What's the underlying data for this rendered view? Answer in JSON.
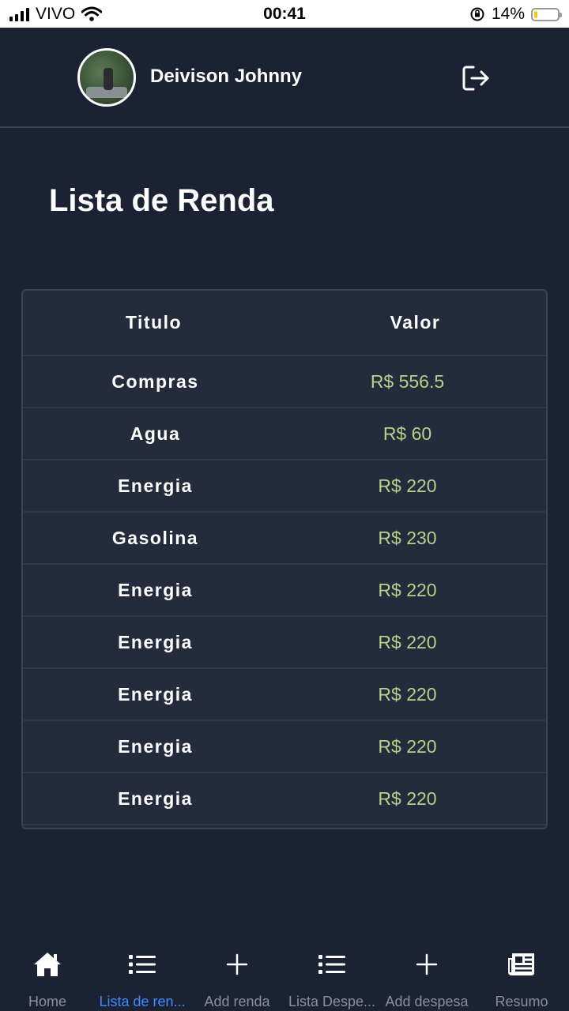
{
  "status_bar": {
    "carrier": "VIVO",
    "time": "00:41",
    "battery": "14%",
    "battery_level": 0.14
  },
  "header": {
    "user_name": "Deivison Johnny"
  },
  "page": {
    "title": "Lista de Renda"
  },
  "table": {
    "columns": [
      "Titulo",
      "Valor"
    ],
    "rows": [
      {
        "titulo": "Compras",
        "valor": "R$ 556.5"
      },
      {
        "titulo": "Agua",
        "valor": "R$ 60"
      },
      {
        "titulo": "Energia",
        "valor": "R$ 220"
      },
      {
        "titulo": "Gasolina",
        "valor": "R$ 230"
      },
      {
        "titulo": "Energia",
        "valor": "R$ 220"
      },
      {
        "titulo": "Energia",
        "valor": "R$ 220"
      },
      {
        "titulo": "Energia",
        "valor": "R$ 220"
      },
      {
        "titulo": "Energia",
        "valor": "R$ 220"
      },
      {
        "titulo": "Energia",
        "valor": "R$ 220"
      }
    ]
  },
  "tabs": [
    {
      "label": "Home",
      "icon": "home-icon",
      "active": false
    },
    {
      "label": "Lista de ren...",
      "icon": "list-icon",
      "active": true
    },
    {
      "label": "Add renda",
      "icon": "plus-icon",
      "active": false
    },
    {
      "label": "Lista Despe...",
      "icon": "list-icon",
      "active": false
    },
    {
      "label": "Add despesa",
      "icon": "plus-icon",
      "active": false
    },
    {
      "label": "Resumo",
      "icon": "newspaper-icon",
      "active": false
    }
  ],
  "colors": {
    "background": "#1b2233",
    "table_bg": "#232b3c",
    "value_green": "#b3d389",
    "active_tab": "#3d8bff",
    "inactive_tab": "#8b8f99"
  }
}
